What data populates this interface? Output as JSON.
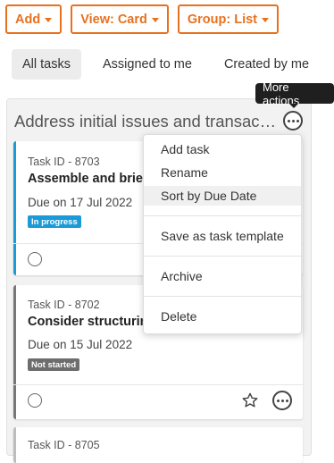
{
  "toolbar": {
    "add_label": "Add",
    "view_label": "View: Card",
    "group_label": "Group: List"
  },
  "tabs": [
    {
      "label": "All tasks",
      "active": true
    },
    {
      "label": "Assigned to me",
      "active": false
    },
    {
      "label": "Created by me",
      "active": false
    }
  ],
  "column": {
    "title": "Address initial issues and transactions",
    "tooltip": "More actions"
  },
  "cards": [
    {
      "id": "Task ID - 8703",
      "name": "Assemble and brief the team",
      "due": "Due on 17 Jul 2022",
      "status": "In progress",
      "status_color": "#1a9ad6",
      "bar_color": "#1a9ad6"
    },
    {
      "id": "Task ID - 8702",
      "name": "Consider structuring",
      "due": "Due on 15 Jul 2022",
      "status": "Not started",
      "status_color": "#6d6d6d",
      "bar_color": "#777777"
    },
    {
      "id": "Task ID - 8705"
    }
  ],
  "menu": {
    "items": [
      {
        "label": "Add task"
      },
      {
        "label": "Rename"
      },
      {
        "label": "Sort by Due Date",
        "hovered": true
      },
      {
        "label": "Save as task template"
      },
      {
        "label": "Archive"
      },
      {
        "label": "Delete"
      }
    ]
  },
  "colors": {
    "accent": "#e8711e",
    "in_progress": "#1a9ad6",
    "not_started": "#6d6d6d"
  },
  "icons": [
    "caret-down-icon",
    "more-actions-icon",
    "star-icon",
    "complete-radio-icon"
  ]
}
